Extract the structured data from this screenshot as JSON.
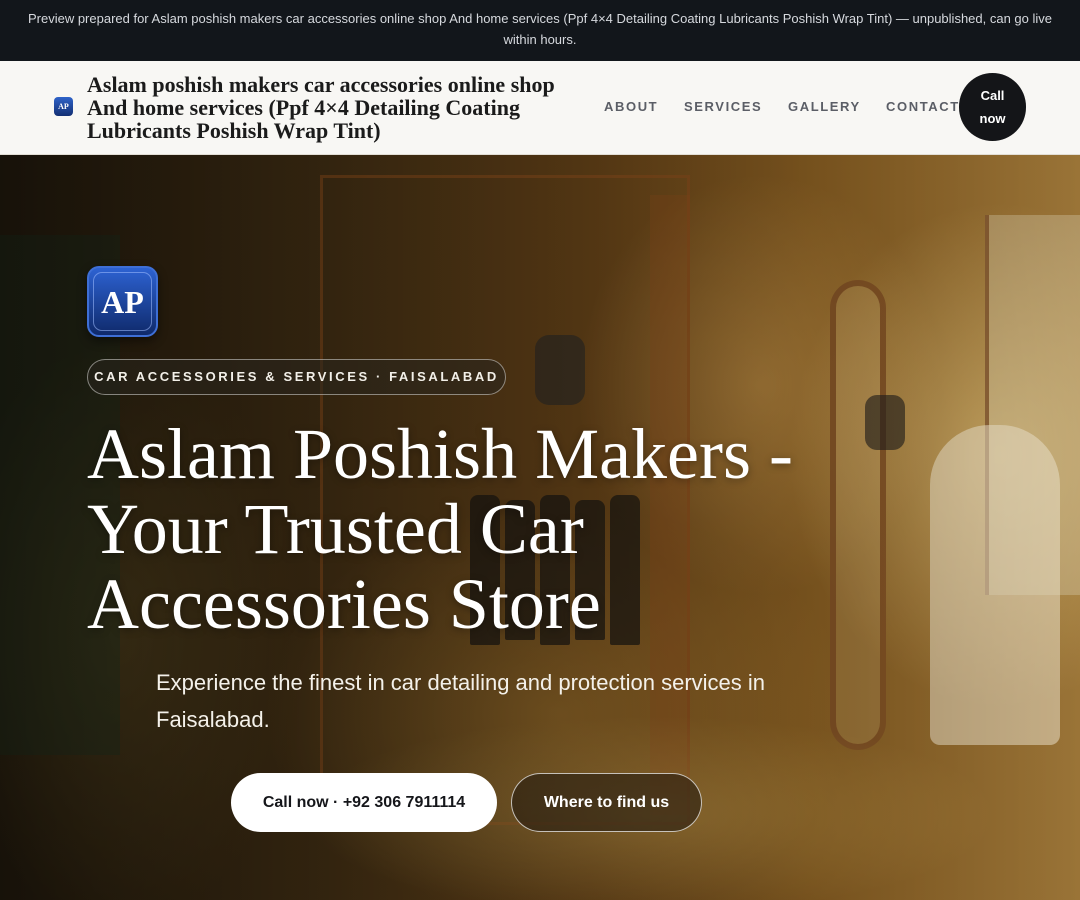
{
  "preview_banner": {
    "text": "Preview prepared for Aslam poshish makers car accessories online shop And home services (Ppf 4×4 Detailing Coating Lubricants Poshish Wrap Tint) — unpublished, can go live within hours."
  },
  "header": {
    "logo_text": "AP",
    "brand_name": "Aslam poshish makers car accessories online shop And home services (Ppf 4×4 Detailing Coating Lubricants Poshish Wrap Tint)",
    "nav": [
      {
        "label": "ABOUT"
      },
      {
        "label": "SERVICES"
      },
      {
        "label": "GALLERY"
      },
      {
        "label": "CONTACT"
      }
    ],
    "call_button": "Call now"
  },
  "hero": {
    "logo_text": "AP",
    "badge": "CAR ACCESSORIES & SERVICES · FAISALABAD",
    "title": "Aslam Poshish Makers - Your Trusted Car Accessories Store",
    "subtitle": "Experience the finest in car detailing and protection services in Faisalabad.",
    "primary_button": "Call now · +92 306 7911114",
    "secondary_button": "Where to find us"
  },
  "colors": {
    "banner_bg": "#12161b",
    "header_bg": "#f8f7f4",
    "brand_blue": "#1f4fb5",
    "call_button_bg": "#141518",
    "hero_overlay": "#2a2010"
  }
}
